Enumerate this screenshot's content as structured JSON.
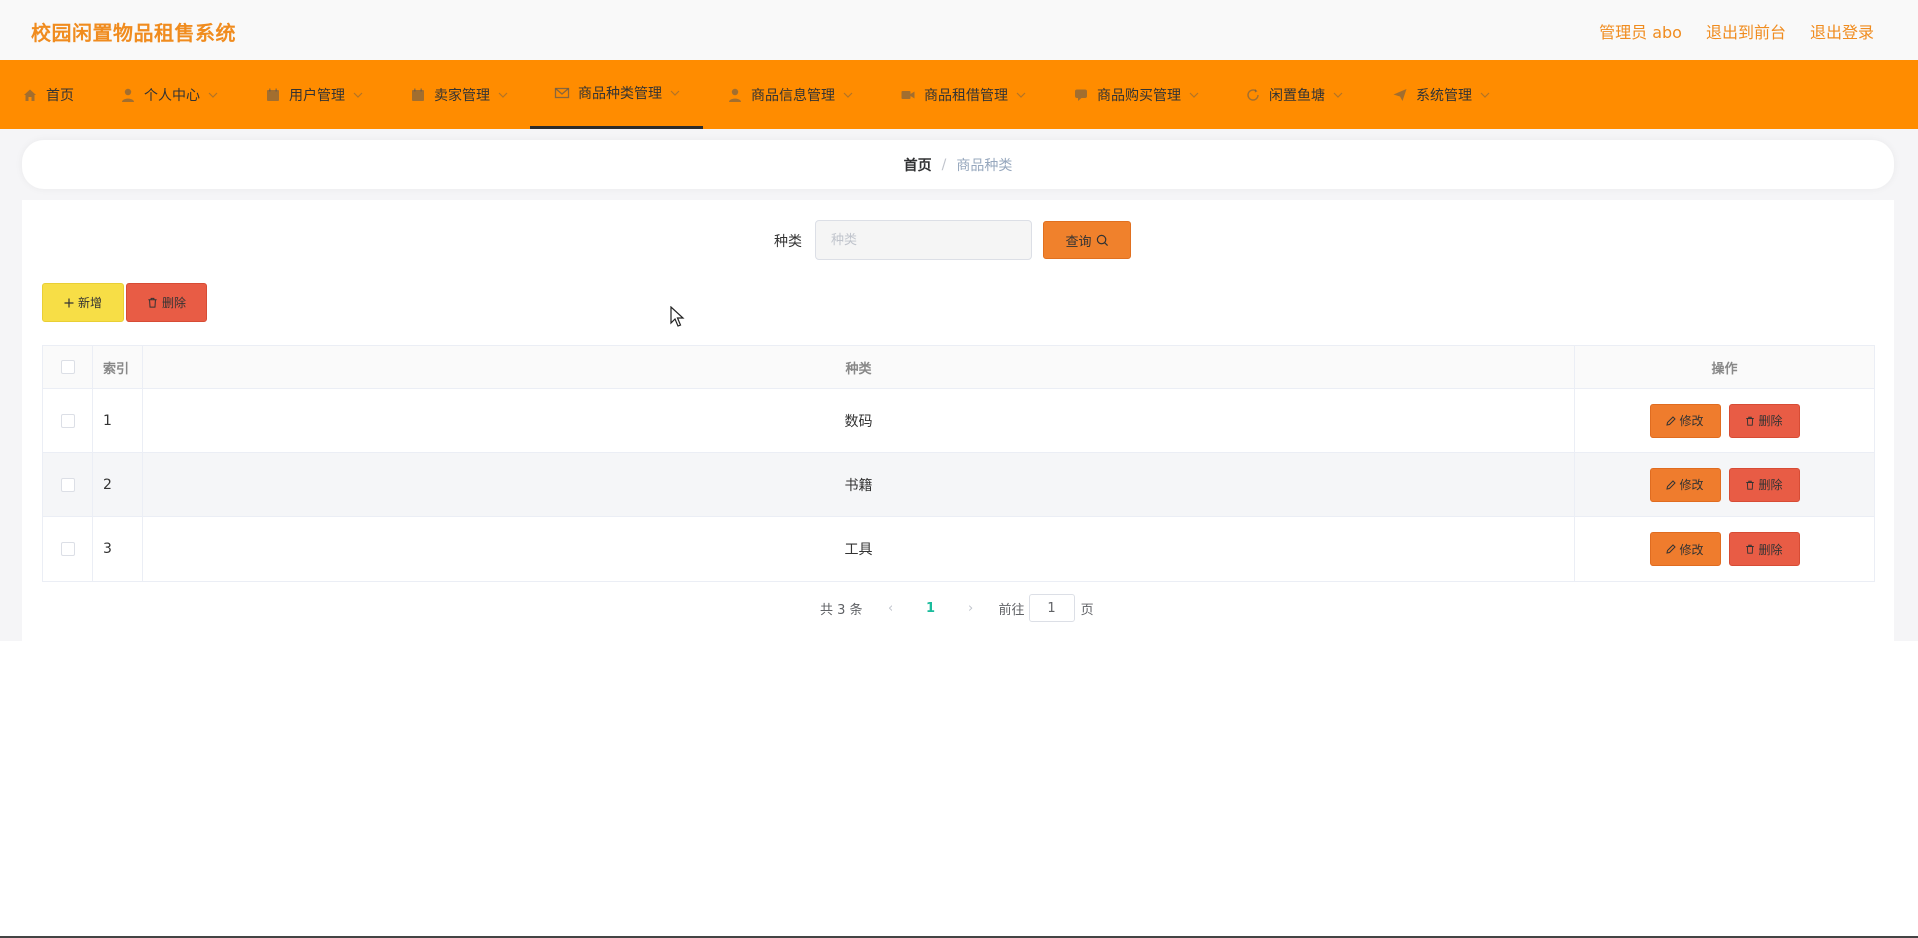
{
  "header": {
    "app_title": "校园闲置物品租售系统",
    "admin_label": "管理员 abo",
    "exit_front": "退出到前台",
    "logout": "退出登录"
  },
  "nav": {
    "items": [
      {
        "label": "首页",
        "icon": "home-icon"
      },
      {
        "label": "个人中心",
        "icon": "user-icon"
      },
      {
        "label": "用户管理",
        "icon": "calendar-icon"
      },
      {
        "label": "卖家管理",
        "icon": "calendar-icon"
      },
      {
        "label": "商品种类管理",
        "icon": "mail-icon"
      },
      {
        "label": "商品信息管理",
        "icon": "user-icon"
      },
      {
        "label": "商品租借管理",
        "icon": "video-icon"
      },
      {
        "label": "商品购买管理",
        "icon": "chat-icon"
      },
      {
        "label": "闲置鱼塘",
        "icon": "refresh-icon"
      },
      {
        "label": "系统管理",
        "icon": "send-icon"
      }
    ]
  },
  "breadcrumb": {
    "home": "首页",
    "separator": "/",
    "current": "商品种类"
  },
  "search": {
    "label": "种类",
    "placeholder": "种类",
    "value": "",
    "button_label": "查询"
  },
  "actions": {
    "add_label": "新增",
    "delete_label": "删除"
  },
  "table": {
    "headers": {
      "index": "索引",
      "kind": "种类",
      "operation": "操作"
    },
    "rows": [
      {
        "index": "1",
        "kind": "数码"
      },
      {
        "index": "2",
        "kind": "书籍"
      },
      {
        "index": "3",
        "kind": "工具"
      }
    ],
    "edit_label": "修改",
    "delete_label": "删除"
  },
  "pagination": {
    "total": "共 3 条",
    "current_page": "1",
    "goto_label": "前往",
    "goto_value": "1",
    "page_suffix": "页"
  },
  "colors": {
    "brand": "#f08c1f",
    "nav_bg": "#ff8c00",
    "add_button": "#f7de46",
    "delete_button": "#e85c45",
    "edit_button": "#ef7c2d",
    "active_page": "#1abc9c"
  }
}
